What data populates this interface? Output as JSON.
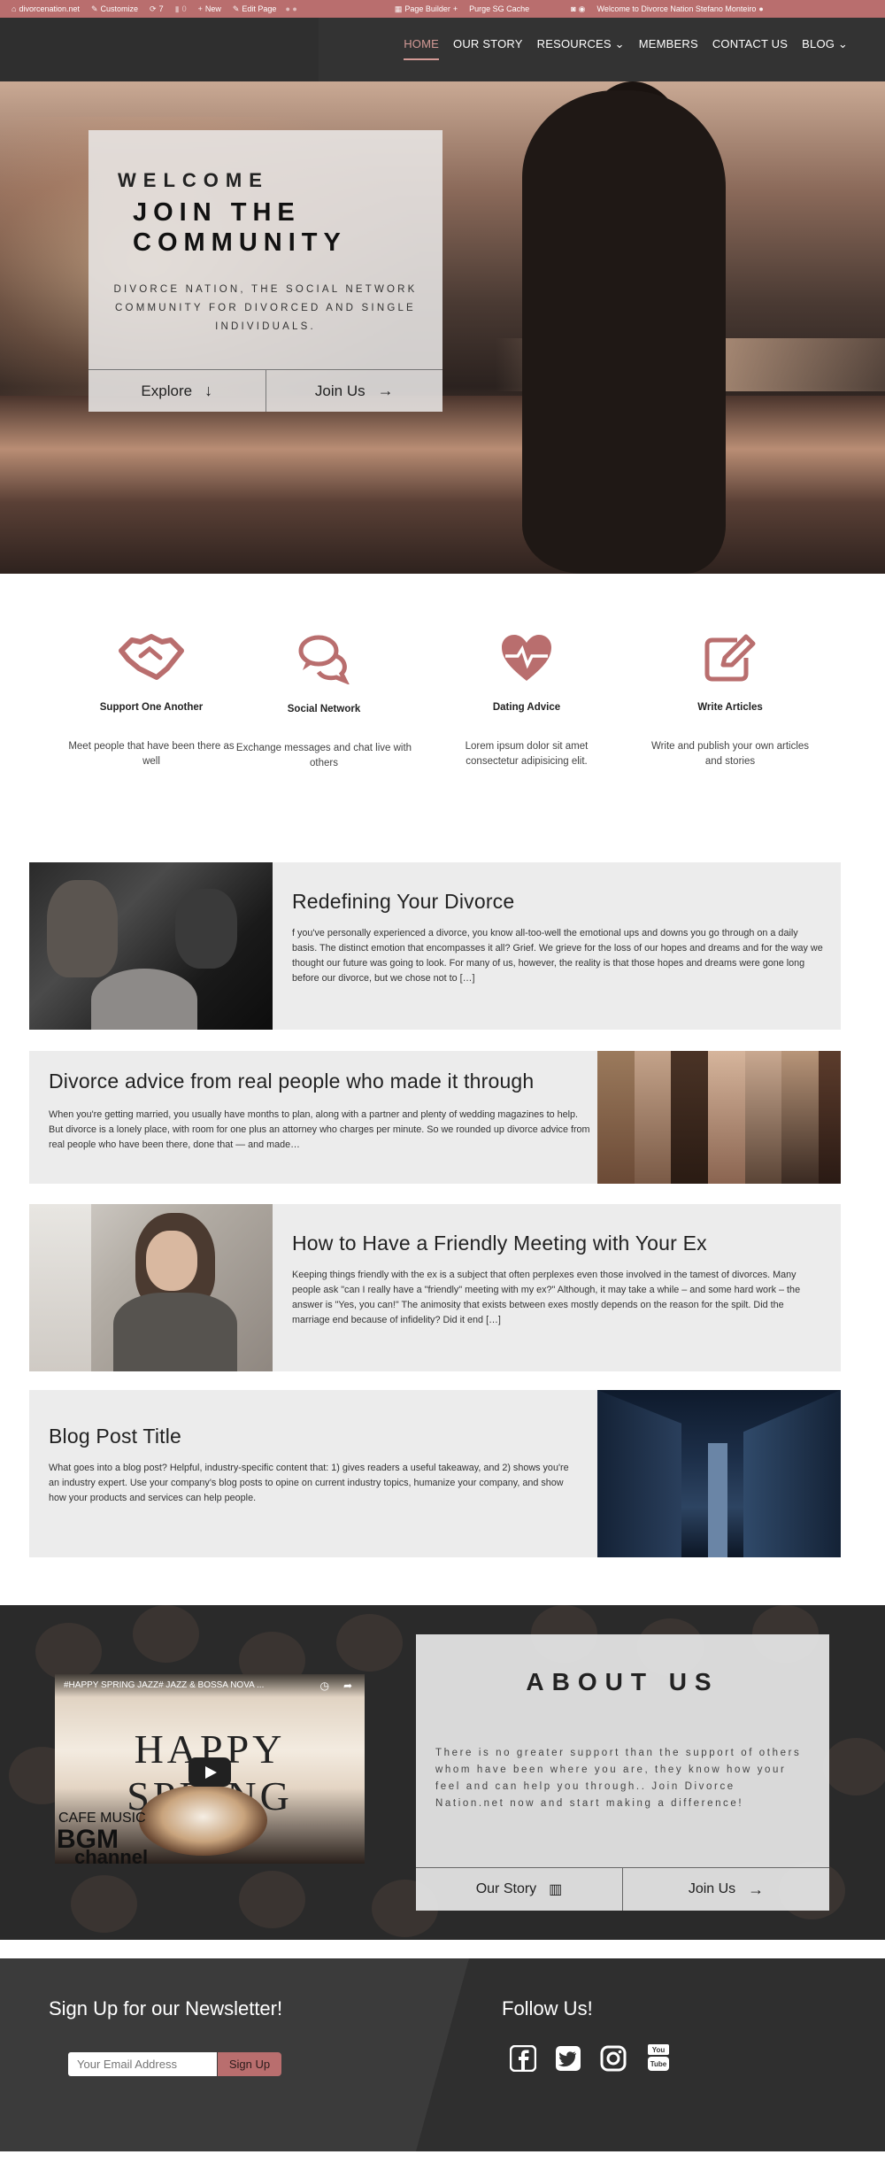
{
  "admin_bar": {
    "site": "divorcenation.net",
    "customize": "Customize",
    "updates": "7",
    "comments": "0",
    "new": "New",
    "edit_page": "Edit Page",
    "page_builder": "Page Builder",
    "purge_cache": "Purge SG Cache",
    "greeting": "Welcome to Divorce Nation Stefano Monteiro"
  },
  "nav": {
    "items": [
      "HOME",
      "OUR STORY",
      "RESOURCES",
      "MEMBERS",
      "CONTACT US",
      "BLOG"
    ],
    "active": "HOME",
    "accent_color": "#d39a96"
  },
  "hero": {
    "welcome": "WELCOME",
    "title": "JOIN THE COMMUNITY",
    "description": "DIVORCE NATION, THE SOCIAL NETWORK COMMUNITY FOR DIVORCED AND SINGLE INDIVIDUALS.",
    "explore_label": "Explore",
    "join_label": "Join Us"
  },
  "features": [
    {
      "icon": "handshake-icon",
      "title": "Support One Another",
      "text": "Meet people that have been there as well"
    },
    {
      "icon": "chat-bubbles-icon",
      "title": "Social Network",
      "text": "Exchange messages and chat live with others"
    },
    {
      "icon": "heartbeat-icon",
      "title": "Dating Advice",
      "text": "Lorem ipsum dolor sit amet consectetur adipisicing elit."
    },
    {
      "icon": "edit-icon",
      "title": "Write Articles",
      "text": "Write and publish your own articles and stories"
    }
  ],
  "posts": [
    {
      "title": "Redefining Your Divorce",
      "excerpt": "f you've personally experienced a divorce, you know all-too-well the emotional ups and downs you go through on a daily basis. The distinct emotion that encompasses it all? Grief. We grieve for the loss of our hopes and dreams and for the way we thought our future was going to look. For many of us, however, the reality is that those hopes and dreams were gone long before our divorce, but we chose not to […]"
    },
    {
      "title": "Divorce advice from real people who made it through",
      "excerpt": "When you're getting married, you usually have months to plan, along with a partner and plenty of wedding magazines to help. But divorce is a lonely place, with room for one plus an attorney who charges per minute. So we rounded up divorce advice from real people who have been there, done that — and made…"
    },
    {
      "title": "How to Have a Friendly Meeting with Your Ex",
      "excerpt": "Keeping things friendly with the ex is a subject that often perplexes even those involved in the tamest of divorces. Many people ask \"can I really have a \"friendly\" meeting with my ex?\" Although, it may take a while – and some hard work – the answer is \"Yes, you can!\" The animosity that exists between exes mostly depends on the reason for the spilt. Did the marriage end because of infidelity? Did it end […]"
    },
    {
      "title": "Blog Post Title",
      "excerpt": "What goes into a blog post? Helpful, industry-specific content that: 1) gives readers a useful takeaway, and 2) shows you're an industry expert. Use your company's blog posts to opine on current industry topics, humanize your company, and show how your products and services can help people."
    }
  ],
  "video": {
    "title": "#HAPPY SPRING JAZZ# JAZZ & BOSSA NOVA ...",
    "big_text": "HAPPY SPRING",
    "cafe": "CAFE MUSIC",
    "bgm": "BGM",
    "channel": "channel"
  },
  "about": {
    "title": "ABOUT US",
    "text": "There is no greater support than the support of others whom have been where you are, they know how your feel and can help you through.. Join Divorce Nation.net now and start making a difference!",
    "story_label": "Our Story",
    "join_label": "Join Us"
  },
  "footer": {
    "newsletter_title": "Sign Up for our Newsletter!",
    "email_placeholder": "Your Email Address",
    "signup_label": "Sign Up",
    "follow_title": "Follow Us!",
    "social": [
      "facebook-icon",
      "twitter-icon",
      "instagram-icon",
      "youtube-icon"
    ]
  },
  "colors": {
    "brand": "#b96e6e",
    "dark": "#333333",
    "card": "#ececec"
  }
}
